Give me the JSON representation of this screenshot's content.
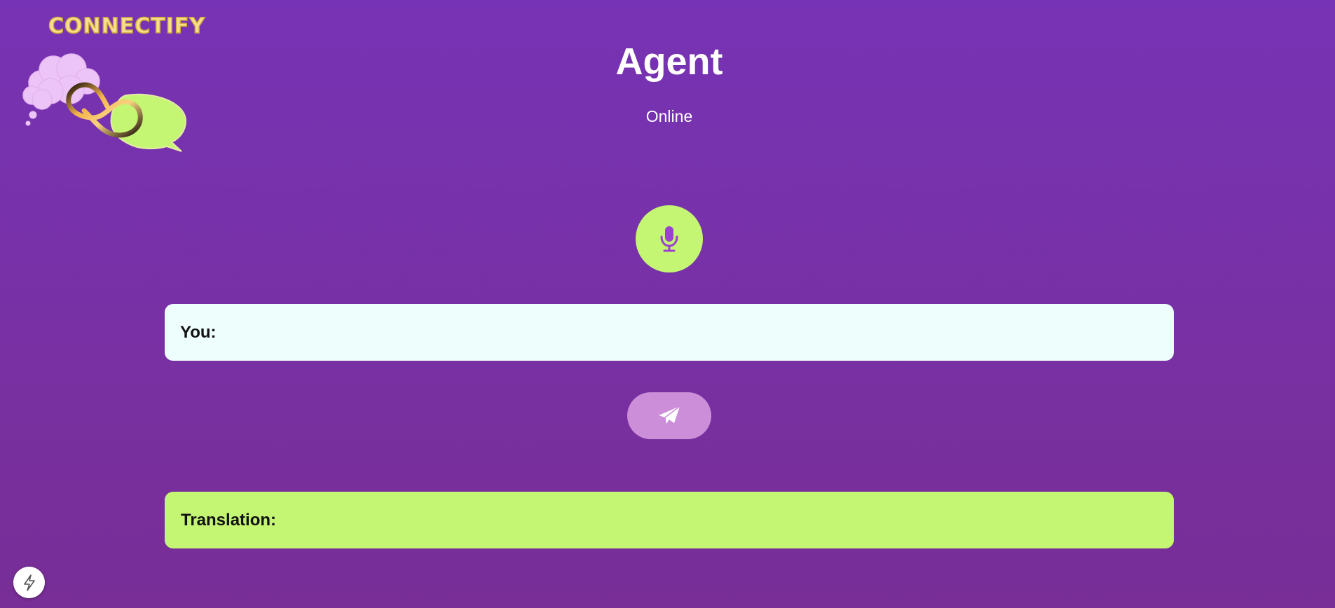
{
  "logo": {
    "text": "CONNECTIFY",
    "icon": "connectify-logo-icon"
  },
  "header": {
    "title": "Agent",
    "status": "Online"
  },
  "mic": {
    "icon": "microphone-icon"
  },
  "input": {
    "label": "You:",
    "value": "",
    "placeholder": ""
  },
  "send": {
    "icon": "paper-plane-icon"
  },
  "translation": {
    "label": "Translation:",
    "value": ""
  },
  "badge": {
    "icon": "lightning-bolt-icon"
  },
  "colors": {
    "background_top": "#7733b5",
    "background_bottom": "#782e96",
    "accent_green": "#c4f674",
    "input_bg": "#eefefd",
    "send_button": "#cc8ed9",
    "mic_icon": "#9b41cc",
    "logo_text": "#f7e08a"
  }
}
